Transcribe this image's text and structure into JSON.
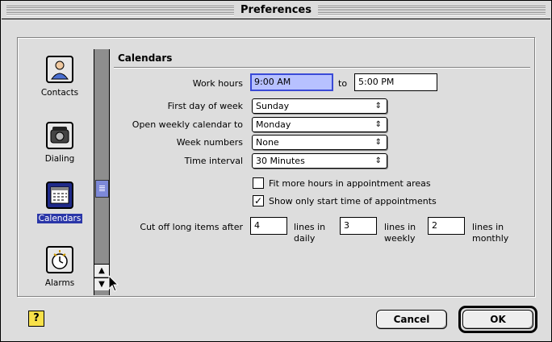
{
  "window": {
    "title": "Preferences"
  },
  "sidebar": {
    "items": [
      {
        "label": "Contacts",
        "icon": "contact-card-icon",
        "selected": false
      },
      {
        "label": "Dialing",
        "icon": "telephone-icon",
        "selected": false
      },
      {
        "label": "Calendars",
        "icon": "calendar-icon",
        "selected": true
      },
      {
        "label": "Alarms",
        "icon": "alarm-clock-icon",
        "selected": false
      }
    ]
  },
  "panel": {
    "title": "Calendars",
    "work_hours_label": "Work hours",
    "work_hours_start": "9:00 AM",
    "work_hours_to": "to",
    "work_hours_end": "5:00 PM",
    "first_day_label": "First day of week",
    "first_day_value": "Sunday",
    "open_weekly_label": "Open weekly calendar to",
    "open_weekly_value": "Monday",
    "week_numbers_label": "Week numbers",
    "week_numbers_value": "None",
    "time_interval_label": "Time interval",
    "time_interval_value": "30 Minutes",
    "fit_hours_label": "Fit more hours in appointment areas",
    "fit_hours_checked": false,
    "show_start_label": "Show only start time of appointments",
    "show_start_checked": true,
    "cutoff_label": "Cut off long items after",
    "cutoff_daily_value": "4",
    "cutoff_daily_label_1": "lines in",
    "cutoff_daily_label_2": "daily",
    "cutoff_weekly_value": "3",
    "cutoff_weekly_label_1": "lines in",
    "cutoff_weekly_label_2": "weekly",
    "cutoff_monthly_value": "2",
    "cutoff_monthly_label_1": "lines in",
    "cutoff_monthly_label_2": "monthly"
  },
  "footer": {
    "help_label": "?",
    "cancel_label": "Cancel",
    "ok_label": "OK"
  },
  "colors": {
    "selection": "#2a36a8",
    "focus": "#3a4ad6",
    "scroll_thumb": "#7d89d8"
  }
}
